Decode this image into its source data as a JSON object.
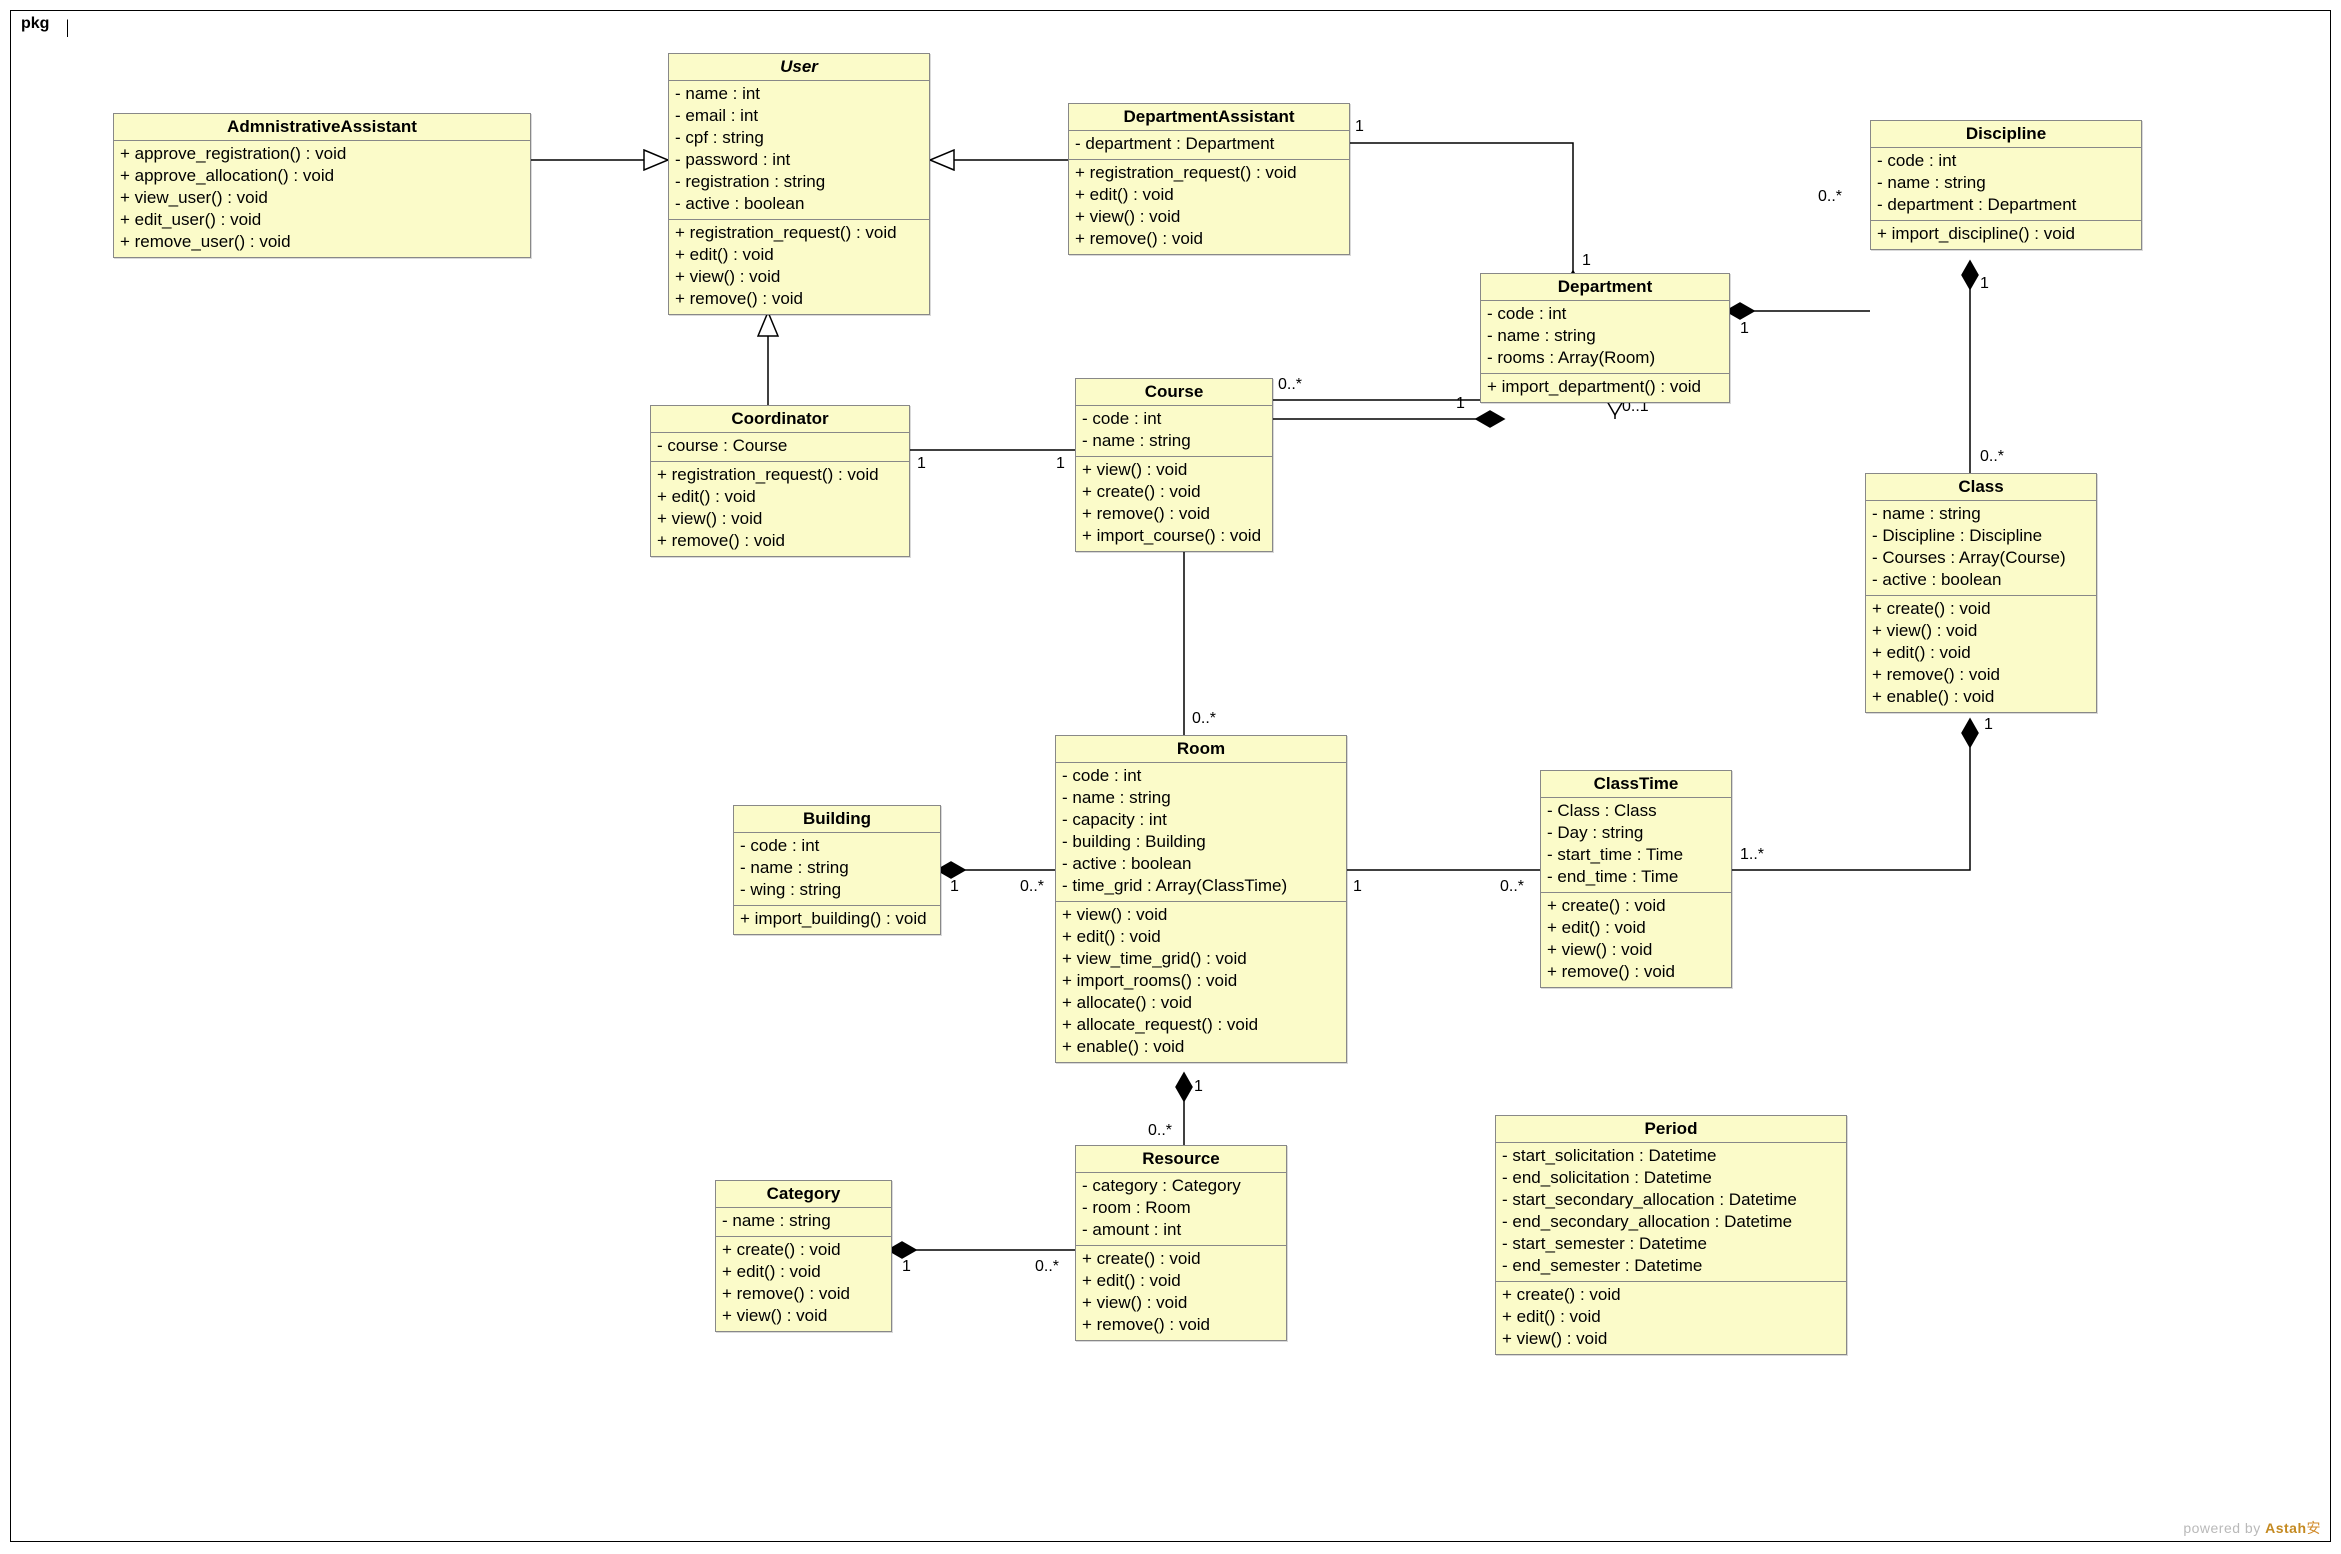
{
  "pkg_label": "pkg",
  "footer": {
    "prefix": "powered by ",
    "brand": "Astah",
    "mark": "安"
  },
  "admin": {
    "name": "AdmnistrativeAssistant",
    "ops": [
      "+ approve_registration() : void",
      "+ approve_allocation() : void",
      "+ view_user() : void",
      "+ edit_user() : void",
      "+ remove_user() : void"
    ]
  },
  "user": {
    "name": "User",
    "attrs": [
      "- name : int",
      "- email : int",
      "- cpf : string",
      "- password : int",
      "- registration : string",
      "- active : boolean"
    ],
    "ops": [
      "+ registration_request() : void",
      "+ edit() : void",
      "+ view() : void",
      "+ remove() : void"
    ]
  },
  "deptassist": {
    "name": "DepartmentAssistant",
    "attrs": [
      "- department : Department"
    ],
    "ops": [
      "+ registration_request() : void",
      "+ edit() : void",
      "+ view() : void",
      "+ remove() : void"
    ]
  },
  "department": {
    "name": "Department",
    "attrs": [
      "- code : int",
      "- name : string",
      "- rooms : Array(Room)"
    ],
    "ops": [
      "+ import_department() : void"
    ]
  },
  "discipline": {
    "name": "Discipline",
    "attrs": [
      "- code : int",
      "- name : string",
      "- department : Department"
    ],
    "ops": [
      "+ import_discipline() : void"
    ]
  },
  "coordinator": {
    "name": "Coordinator",
    "attrs": [
      "- course : Course"
    ],
    "ops": [
      "+ registration_request() : void",
      "+ edit() : void",
      "+ view() : void",
      "+ remove() : void"
    ]
  },
  "course": {
    "name": "Course",
    "attrs": [
      "- code : int",
      "- name : string"
    ],
    "ops": [
      "+ view() : void",
      "+ create() : void",
      "+ remove() : void",
      "+ import_course() : void"
    ]
  },
  "klass": {
    "name": "Class",
    "attrs": [
      "- name : string",
      "- Discipline : Discipline",
      "- Courses : Array(Course)",
      "- active : boolean"
    ],
    "ops": [
      "+ create() : void",
      "+ view() : void",
      "+ edit() : void",
      "+ remove() : void",
      "+ enable() : void"
    ]
  },
  "building": {
    "name": "Building",
    "attrs": [
      "- code : int",
      "- name : string",
      "- wing : string"
    ],
    "ops": [
      "+ import_building() : void"
    ]
  },
  "room": {
    "name": "Room",
    "attrs": [
      "- code : int",
      "- name : string",
      "- capacity : int",
      "- building : Building",
      "- active : boolean",
      "- time_grid : Array(ClassTime)"
    ],
    "ops": [
      "+ view() : void",
      "+ edit() : void",
      "+ view_time_grid() : void",
      "+ import_rooms() : void",
      "+ allocate() : void",
      "+ allocate_request() : void",
      "+ enable() : void"
    ]
  },
  "classtime": {
    "name": "ClassTime",
    "attrs": [
      "- Class : Class",
      "- Day : string",
      "- start_time : Time",
      "- end_time : Time"
    ],
    "ops": [
      "+ create() : void",
      "+ edit() : void",
      "+ view() : void",
      "+ remove() : void"
    ]
  },
  "category": {
    "name": "Category",
    "attrs": [
      "- name : string"
    ],
    "ops": [
      "+ create() : void",
      "+ edit() : void",
      "+ remove() : void",
      "+ view() : void"
    ]
  },
  "resource": {
    "name": "Resource",
    "attrs": [
      "- category : Category",
      "- room : Room",
      "- amount : int"
    ],
    "ops": [
      "+ create() : void",
      "+ edit() : void",
      "+ view() : void",
      "+ remove() : void"
    ]
  },
  "period": {
    "name": "Period",
    "attrs": [
      "- start_solicitation : Datetime",
      "- end_solicitation : Datetime",
      "- start_secondary_allocation : Datetime",
      "- end_secondary_allocation : Datetime",
      "- start_semester : Datetime",
      "- end_semester : Datetime"
    ],
    "ops": [
      "+ create() : void",
      "+ edit() : void",
      "+ view() : void"
    ]
  },
  "mult": {
    "deptassist_dept_src": "1",
    "deptassist_dept_dst": "1",
    "dept_course_src": "0..1",
    "dept_course_dst": "0..*",
    "dept_discipline_src": "1",
    "dept_discipline_dst": "0..*",
    "discipline_class_src": "1",
    "discipline_class_dst": "0..*",
    "coord_course_src": "1",
    "coord_course_dst": "1",
    "dept_room_src": "1",
    "dept_room_dst": "0..*",
    "building_room_src": "1",
    "building_room_dst": "0..*",
    "room_classtime_src": "1",
    "room_classtime_dst": "0..*",
    "classtime_class_src": "1..*",
    "classtime_class_dst": "1",
    "room_resource_src": "1",
    "room_resource_dst": "0..*",
    "category_resource_src": "1",
    "category_resource_dst": "0..*"
  }
}
